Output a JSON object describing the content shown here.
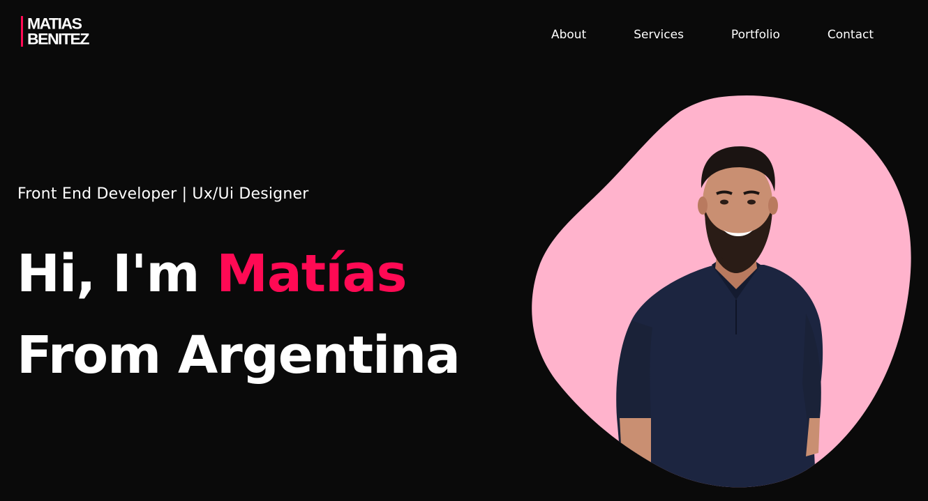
{
  "brand": {
    "line1": "MATIAS",
    "line2": "BENITEZ",
    "accent_color": "#ff0a54"
  },
  "nav": {
    "items": [
      {
        "label": "About"
      },
      {
        "label": "Services"
      },
      {
        "label": "Portfolio"
      },
      {
        "label": "Contact"
      }
    ]
  },
  "hero": {
    "subtitle": "Front End Developer | Ux/Ui Designer",
    "greeting": "Hi, I'm",
    "name": "Matías",
    "line2": "From Argentina",
    "blob_color": "#ffb3cc",
    "shirt_color": "#1c2540"
  },
  "colors": {
    "background": "#0a0a0a",
    "text": "#ffffff",
    "accent": "#ff0a54"
  }
}
